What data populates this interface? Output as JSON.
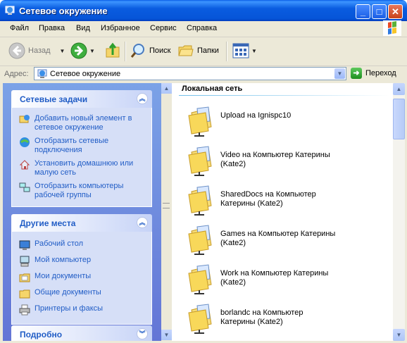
{
  "window": {
    "title": "Сетевое окружение",
    "buttons": {
      "minimize": "_",
      "maximize": "□",
      "close": "✕"
    }
  },
  "menu": [
    "Файл",
    "Правка",
    "Вид",
    "Избранное",
    "Сервис",
    "Справка"
  ],
  "toolbar": {
    "back_label": "Назад",
    "search_label": "Поиск",
    "folders_label": "Папки"
  },
  "address": {
    "label": "Адрес:",
    "value": "Сетевое окружение",
    "go_label": "Переход"
  },
  "network_tasks": {
    "title": "Сетевые задачи",
    "items": [
      {
        "label": "Добавить новый элемент в сетевое окружение",
        "icon": "add-network-place-icon"
      },
      {
        "label": "Отобразить сетевые подключения",
        "icon": "network-connections-icon"
      },
      {
        "label": "Установить домашнюю или малую сеть",
        "icon": "home-network-icon"
      },
      {
        "label": "Отобразить компьютеры рабочей группы",
        "icon": "workgroup-computers-icon"
      }
    ]
  },
  "other_places": {
    "title": "Другие места",
    "items": [
      {
        "label": "Рабочий стол",
        "icon": "desktop-icon"
      },
      {
        "label": "Мой компьютер",
        "icon": "my-computer-icon"
      },
      {
        "label": "Мои документы",
        "icon": "my-documents-icon"
      },
      {
        "label": "Общие документы",
        "icon": "shared-documents-icon"
      },
      {
        "label": "Принтеры и факсы",
        "icon": "printers-icon"
      }
    ]
  },
  "details": {
    "title": "Подробно"
  },
  "content": {
    "group_title": "Локальная сеть",
    "shares": [
      "Upload на Ignispc10",
      "Video на Компьютер Катерины (Kate2)",
      "SharedDocs на Компьютер Катерины (Kate2)",
      "Games на Компьютер Катерины (Kate2)",
      "Work на Компьютер Катерины (Kate2)",
      "borlandc на Компьютер Катерины (Kate2)"
    ]
  },
  "colors": {
    "title_bar": "#0a5ce0",
    "task_link": "#215dc6",
    "pane_bg": "#6d8be0"
  }
}
